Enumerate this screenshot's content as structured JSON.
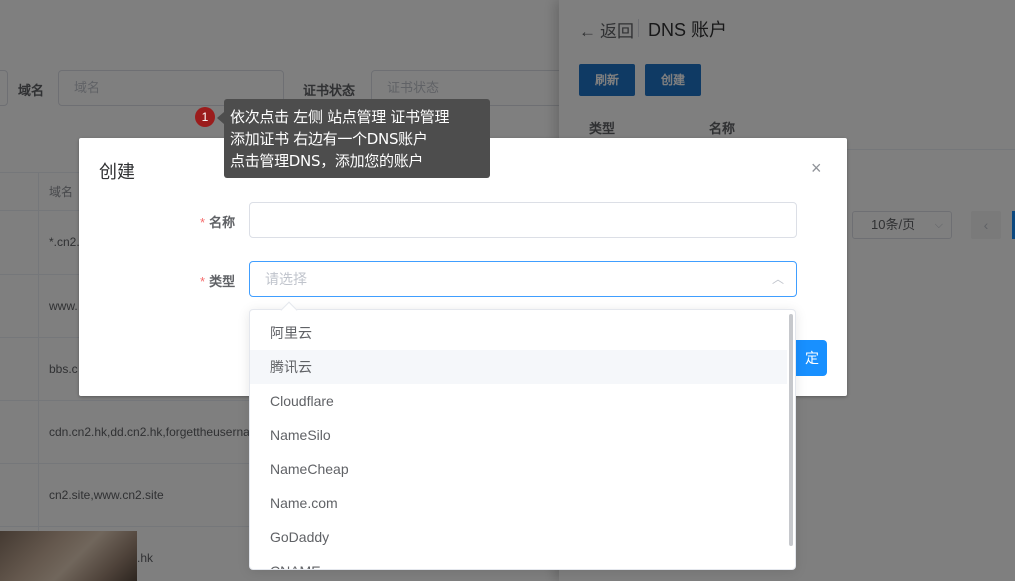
{
  "filters": {
    "domain_label": "域名",
    "domain_placeholder": "域名",
    "cert_status_label": "证书状态",
    "cert_status_placeholder": "证书状态"
  },
  "table": {
    "domain_header": "域名",
    "rows": [
      "*.cn2.",
      "www.",
      "bbs.c",
      "cdn.cn2.hk,dd.cn2.hk,forgettheuserna",
      "cn2.site,www.cn2.site",
      ".hk"
    ]
  },
  "drawer": {
    "back_arrow": "←",
    "back_label": "返回",
    "title": "DNS 账户",
    "refresh_button": "刷新",
    "create_button": "创建",
    "col_type": "类型",
    "col_name": "名称",
    "page_size": "10条/页",
    "page_size_caret": "⌵",
    "prev_icon": "‹"
  },
  "dialog": {
    "title": "创建",
    "close_icon": "×",
    "name_label": "名称",
    "type_label": "类型",
    "required_mark": "*",
    "type_placeholder": "请选择",
    "chevron": "︿",
    "confirm_partial": "定"
  },
  "dropdown": {
    "options": [
      "阿里云",
      "腾讯云",
      "Cloudflare",
      "NameSilo",
      "NameCheap",
      "Name.com",
      "GoDaddy",
      "CNAME"
    ],
    "hovered_index": 1
  },
  "tooltip": {
    "step_number": "1",
    "line1": "依次点击  左侧 站点管理  证书管理",
    "line2": "添加证书  右边有一个DNS账户",
    "line3": "点击管理DNS，添加您的账户"
  },
  "colors": {
    "primary": "#1890ff",
    "drawer_button": "#1f74c9",
    "badge": "#9b1c1c",
    "required": "#f56c6c"
  }
}
